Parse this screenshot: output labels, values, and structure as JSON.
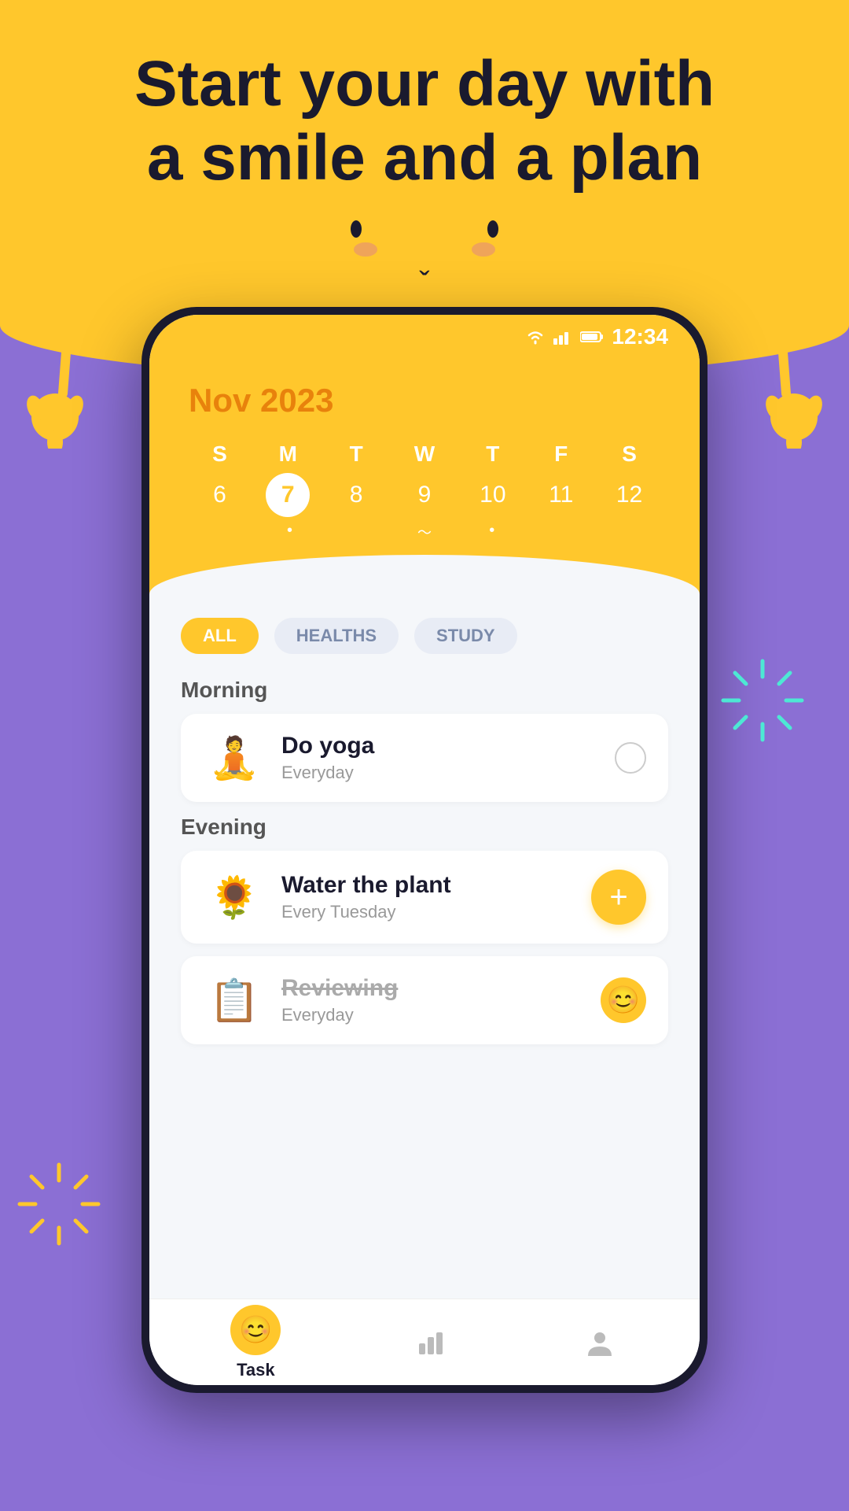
{
  "header": {
    "title_line1": "Start your day with",
    "title_line2": "a smile and a plan"
  },
  "phone": {
    "status": {
      "time": "12:34"
    },
    "calendar": {
      "month_year": "Nov 2023",
      "day_headers": [
        "S",
        "M",
        "T",
        "W",
        "T",
        "F",
        "S"
      ],
      "days": [
        "6",
        "7",
        "8",
        "9",
        "10",
        "11",
        "12"
      ],
      "selected_day": "7",
      "dots": [
        "",
        "•",
        "",
        "~",
        "•",
        "",
        ""
      ]
    },
    "filters": [
      {
        "label": "ALL",
        "active": true
      },
      {
        "label": "HEALTHS",
        "active": false
      },
      {
        "label": "STUDY",
        "active": false
      }
    ],
    "sections": [
      {
        "label": "Morning",
        "tasks": [
          {
            "emoji": "🧘",
            "title": "Do yoga",
            "subtitle": "Everyday",
            "action": "check",
            "strikethrough": false
          }
        ]
      },
      {
        "label": "Evening",
        "tasks": [
          {
            "emoji": "🌻",
            "title": "Water the plant",
            "subtitle": "Every Tuesday",
            "action": "add",
            "strikethrough": false
          },
          {
            "emoji": "📋",
            "title": "Reviewing",
            "subtitle": "Everyday",
            "action": "smile",
            "strikethrough": true
          }
        ]
      }
    ],
    "bottom_nav": [
      {
        "icon": "😊",
        "label": "Task",
        "active": true
      },
      {
        "icon": "chart",
        "label": "",
        "active": false
      },
      {
        "icon": "person",
        "label": "",
        "active": false
      }
    ]
  },
  "colors": {
    "yellow": "#FFC72C",
    "purple": "#8b6fd4",
    "dark": "#1a1a2e",
    "cyan": "#4de8d4"
  }
}
